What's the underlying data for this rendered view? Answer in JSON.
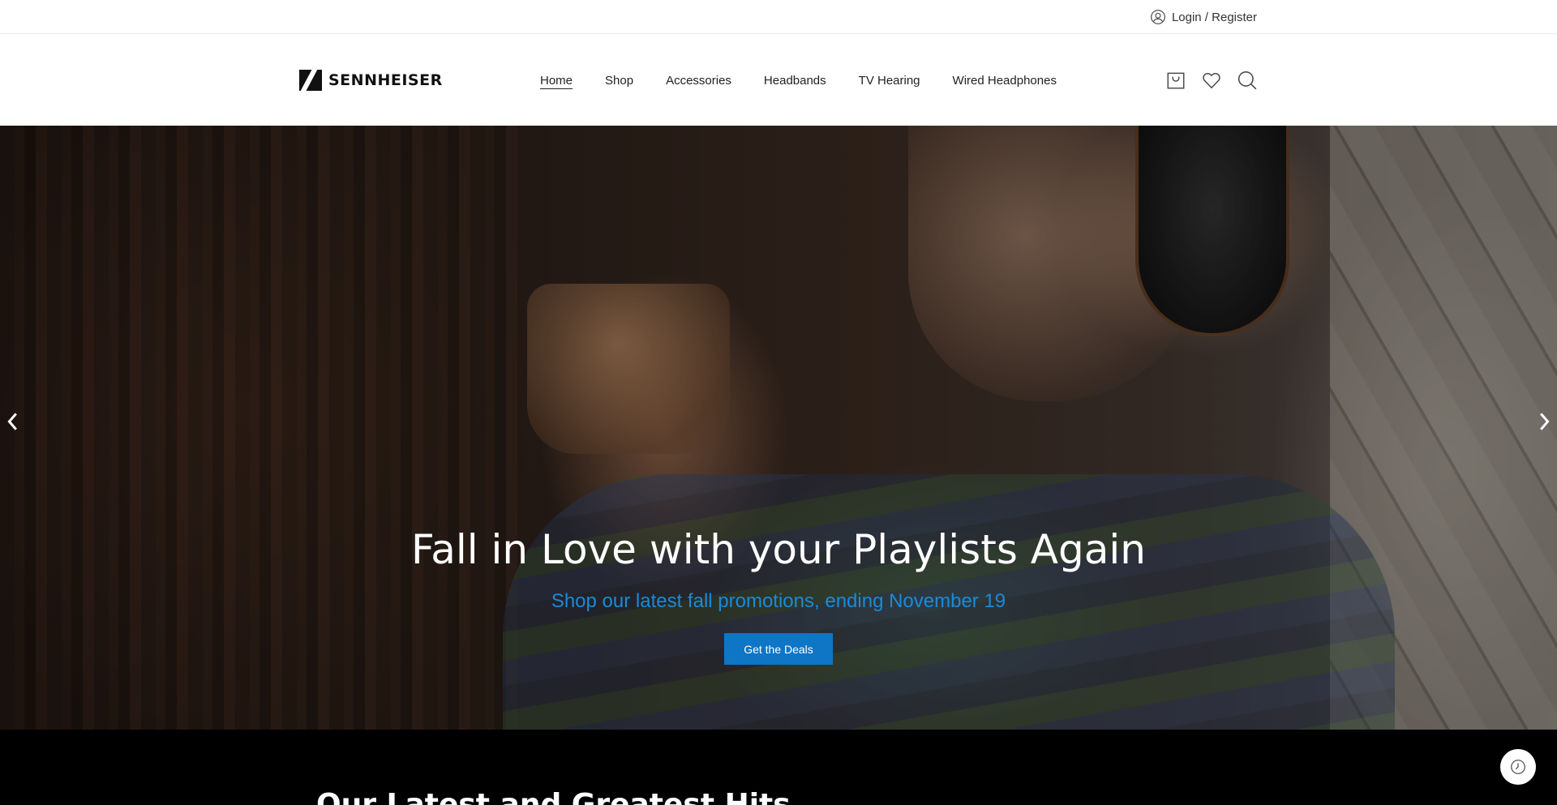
{
  "topbar": {
    "login_label": "Login / Register",
    "user_icon": "user-icon"
  },
  "header": {
    "brand": "SENNHEISER",
    "nav": [
      {
        "label": "Home",
        "active": true
      },
      {
        "label": "Shop"
      },
      {
        "label": "Accessories"
      },
      {
        "label": "Headbands"
      },
      {
        "label": "TV Hearing"
      },
      {
        "label": "Wired Headphones"
      }
    ],
    "icons": [
      "cart-icon",
      "heart-icon",
      "search-icon"
    ]
  },
  "hero": {
    "title": "Fall in Love with your Playlists Again",
    "subtitle": "Shop our latest fall promotions, ending November 19",
    "cta_label": "Get the Deals",
    "subtitle_color": "#1c8ad6",
    "cta_color": "#0f75c5"
  },
  "section": {
    "title": "Our Latest and Greatest Hits"
  }
}
